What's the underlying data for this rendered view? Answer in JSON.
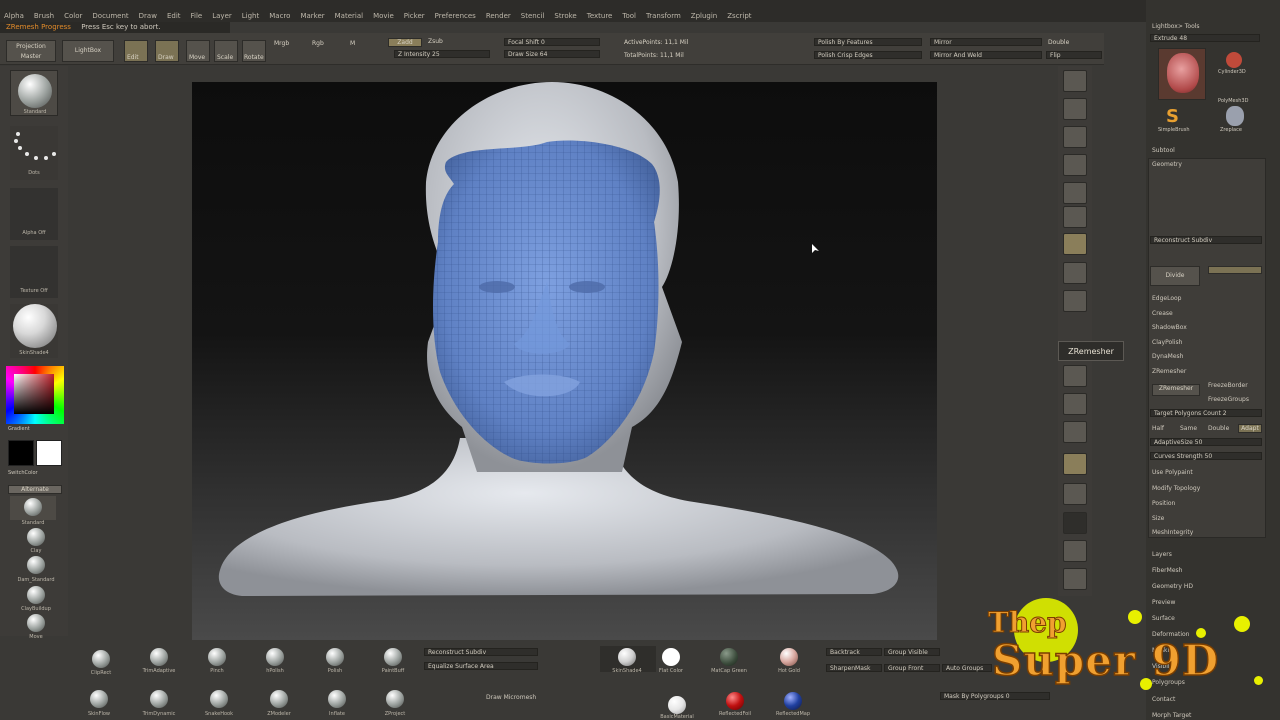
{
  "menu": [
    "Alpha",
    "Brush",
    "Color",
    "Document",
    "Draw",
    "Edit",
    "File",
    "Layer",
    "Light",
    "Macro",
    "Marker",
    "Material",
    "Movie",
    "Picker",
    "Preferences",
    "Render",
    "Stencil",
    "Stroke",
    "Texture",
    "Tool",
    "Transform",
    "Zplugin",
    "Zscript"
  ],
  "progress": {
    "label": "ZRemesh Progress",
    "hint": "Press Esc key to abort."
  },
  "topbar": {
    "projection_master": "Projection Master",
    "lightbox": "LightBox",
    "edit": "Edit",
    "draw": "Draw",
    "move": "Move",
    "scale": "Scale",
    "rotate": "Rotate",
    "mrgb": "Mrgb",
    "rgb": "Rgb",
    "m": "M",
    "zadd": "Zadd",
    "zsub": "Zsub",
    "z_intensity": "Z Intensity 25",
    "focal_shift": "Focal Shift 0",
    "draw_size": "Draw Size 64",
    "active_points": "ActivePoints: 11,1 Mil",
    "total_points": "TotalPoints: 11,1 Mil",
    "polish_by_features": "Polish By Features",
    "polish_crisp_edges": "Polish Crisp Edges",
    "mirror": "Mirror",
    "mirror_and_weld": "Mirror And Weld",
    "double": "Double",
    "flip": "Flip"
  },
  "left_shelf": [
    "Standard",
    "Dots",
    "Alpha Off",
    "Texture Off",
    "SkinShade4",
    "Gradient",
    "SwitchColor",
    "Alternate",
    "Standard",
    "Clay",
    "Dam_Standard",
    "ClayBuildup",
    "Move"
  ],
  "right_panel": {
    "header": "Lightbox> Tools",
    "extract": "Extrude 48",
    "tools": [
      "Cylinder3D",
      "PolyMesh3D",
      "SimpleBrush",
      "Zreplace"
    ],
    "subtool": "Subtool",
    "geometry": "Geometry",
    "reconstruct": "Reconstruct Subdiv",
    "divide": "Divide",
    "edgeloop": "EdgeLoop",
    "crease": "Crease",
    "shadowbox": "ShadowBox",
    "claypolish": "ClayPolish",
    "dynamesh": "DynaMesh",
    "zremesher": "ZRemesher",
    "freeze_border": "FreezeBorder",
    "freeze_groups": "FreezeGroups",
    "target_polygons": "Target Polygons Count 2",
    "half_same_double": [
      "Half",
      "Same",
      "Double",
      "Adapt"
    ],
    "adaptive_size": "AdaptiveSize 50",
    "curves_strength": "Curves Strength 50",
    "use_polypaint": "Use Polypaint",
    "modify_topology": "Modify Topology",
    "position": "Position",
    "size": "Size",
    "mesh_integrity": "MeshIntegrity",
    "sections": [
      "Layers",
      "FiberMesh",
      "Geometry HD",
      "Preview",
      "Surface",
      "Deformation",
      "Masking",
      "Visibility",
      "Polygroups",
      "Contact",
      "Morph Target"
    ]
  },
  "tooltip": "ZRemesher",
  "bottom": {
    "brushes_row1": [
      "ClipRect",
      "TrimAdaptive",
      "Pinch",
      "hPolish",
      "Polish",
      "PaintBuff"
    ],
    "brushes_row2": [
      "SkinFlow",
      "TrimDynamic",
      "SnakeHook",
      "ZModeler",
      "Inflate",
      "ZProject"
    ],
    "reconstruct": "Reconstruct Subdiv",
    "equalize": "Equalize Surface Area",
    "draw_micromesh": "Draw Micromesh",
    "materials": [
      "SkinShade4",
      "Flat Color",
      "MatCap Green",
      "Hot Gold"
    ],
    "materials2": [
      "BasicMaterial",
      "ReflectedFoil",
      "ReflectedMap"
    ],
    "backtrack": "Backtrack",
    "group_visible": "Group Visible",
    "group_front": "Group Front",
    "auto_groups": "Auto Groups",
    "sharpen_mask": "SharpenMask",
    "mask_by_polygroups": "Mask By Polygroups 0"
  },
  "logo": {
    "line1": "Thep",
    "line2": "Super 9D"
  },
  "colors": {
    "accent": "#e08a2a",
    "mesh_blue": "#6c8fd0",
    "logo": "#f0a030"
  }
}
